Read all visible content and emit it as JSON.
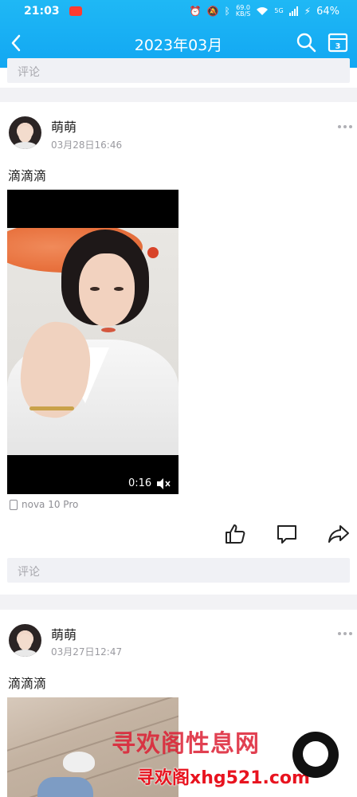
{
  "status": {
    "time": "21:03",
    "net_speed_value": "69.0",
    "net_speed_unit": "KB/S",
    "signal": "5G",
    "battery": "64%"
  },
  "header": {
    "title": "2023年03月",
    "calendar_day": "3"
  },
  "feed": {
    "prev_comment_placeholder": "评论",
    "posts": [
      {
        "author": "萌萌",
        "time": "03月28日16:46",
        "text": "滴滴滴",
        "video_duration": "0:16",
        "device": "nova 10 Pro",
        "comment_placeholder": "评论"
      },
      {
        "author": "萌萌",
        "time": "03月27日12:47",
        "text": "滴滴滴"
      }
    ]
  },
  "watermark": {
    "text": "寻欢阁性息网",
    "url": "寻欢阁xhg521.com"
  },
  "colors": {
    "header": "#12a7f2",
    "watermark": "#e8131f"
  }
}
